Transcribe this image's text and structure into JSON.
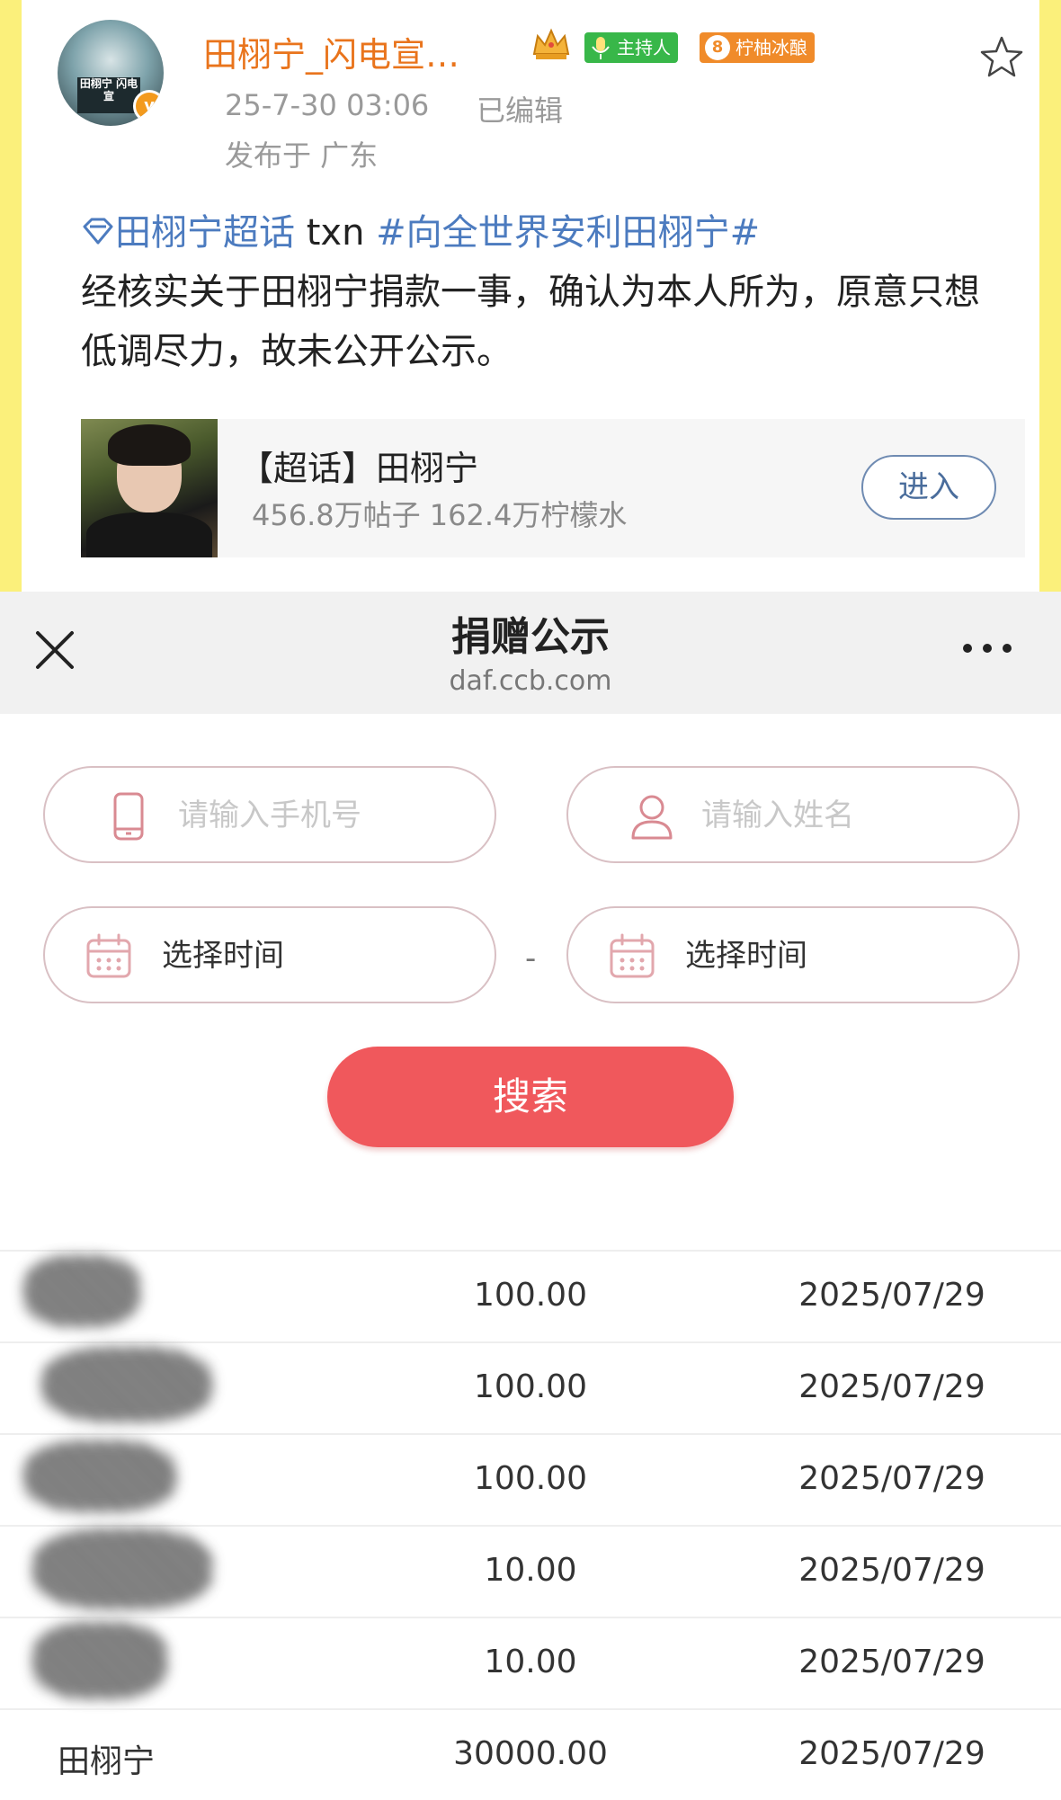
{
  "post": {
    "username": "田栩宁_闪电宣…",
    "badge_host": "主持人",
    "badge_fan_level": "8",
    "badge_fan": "柠柚冰酿",
    "avatar_caption": "田栩宁 闪电宣",
    "time": "25-7-30 03:06",
    "edited": "已编辑",
    "location": "发布于 广东",
    "supertopic": "田栩宁超话",
    "tag_plain": " txn ",
    "hashtag": "#向全世界安利田栩宁#",
    "body": "经核实关于田栩宁捐款一事，确认为本人所为，原意只想低调尽力，故未公开公示。",
    "card": {
      "title": "【超话】田栩宁",
      "stats": "456.8万帖子 162.4万柠檬水",
      "enter": "进入"
    }
  },
  "browser": {
    "title": "捐赠公示",
    "url": "daf.ccb.com"
  },
  "form": {
    "phone_placeholder": "请输入手机号",
    "name_placeholder": "请输入姓名",
    "start_time": "选择时间",
    "end_time": "选择时间",
    "range_sep": "-",
    "search": "搜索"
  },
  "results": [
    {
      "name": "",
      "amount": "100.00",
      "date": "2025/07/29"
    },
    {
      "name": "",
      "amount": "100.00",
      "date": "2025/07/29"
    },
    {
      "name": "",
      "amount": "100.00",
      "date": "2025/07/29"
    },
    {
      "name": "",
      "amount": "10.00",
      "date": "2025/07/29"
    },
    {
      "name": "",
      "amount": "10.00",
      "date": "2025/07/29"
    },
    {
      "name": "田栩宁",
      "amount": "30000.00",
      "date": "2025/07/29"
    }
  ],
  "colors": {
    "accent_red": "#f0585c",
    "username_orange": "#e9741c",
    "link_blue": "#4c7bbf",
    "border_yellow": "#fbf07b"
  }
}
